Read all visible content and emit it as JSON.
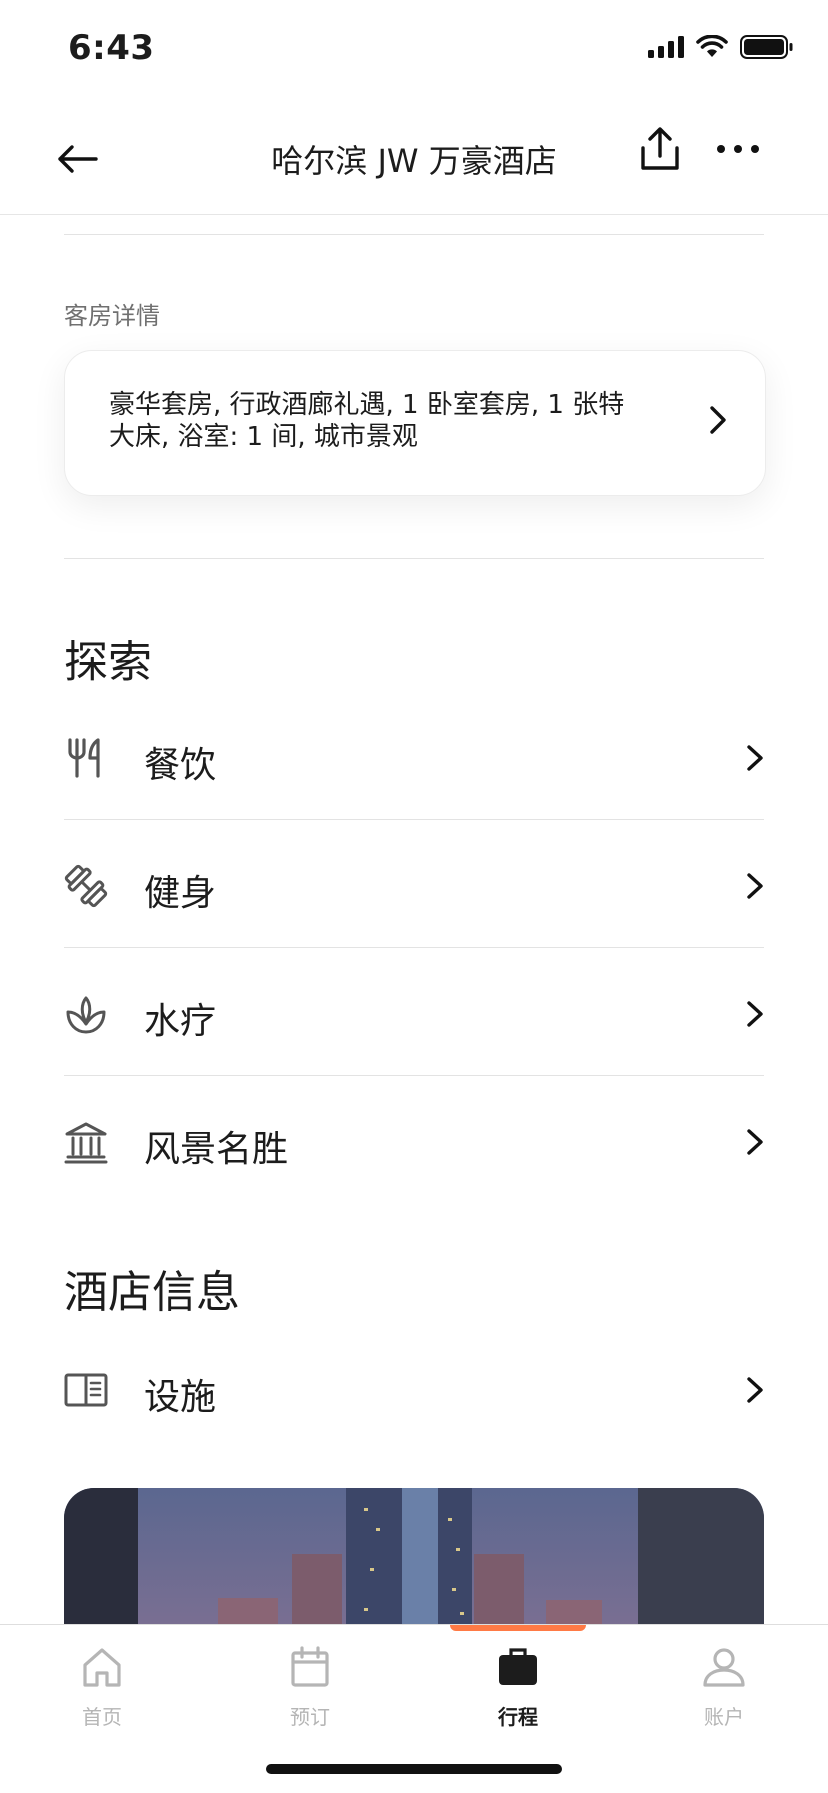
{
  "status_bar": {
    "time": "6:43"
  },
  "header": {
    "title": "哈尔滨 JW 万豪酒店"
  },
  "room": {
    "section_label": "客房详情",
    "description": "豪华套房, 行政酒廊礼遇, 1 卧室套房, 1  张特大床, 浴室: 1 间, 城市景观"
  },
  "explore": {
    "title": "探索",
    "items": [
      {
        "label": "餐饮",
        "icon": "fork-knife-icon"
      },
      {
        "label": "健身",
        "icon": "dumbbell-icon"
      },
      {
        "label": "水疗",
        "icon": "lotus-icon"
      },
      {
        "label": "风景名胜",
        "icon": "landmark-icon"
      }
    ]
  },
  "hotel_info": {
    "title": "酒店信息",
    "items": [
      {
        "label": "设施",
        "icon": "book-icon"
      }
    ]
  },
  "tabbar": {
    "items": [
      {
        "label": "首页",
        "icon": "home-icon",
        "active": false
      },
      {
        "label": "预订",
        "icon": "calendar-icon",
        "active": false
      },
      {
        "label": "行程",
        "icon": "briefcase-icon",
        "active": true
      },
      {
        "label": "账户",
        "icon": "person-icon",
        "active": false
      }
    ]
  },
  "colors": {
    "accent": "#ff7a45",
    "text": "#1c1c1c",
    "inactive": "#b5b5b5"
  }
}
